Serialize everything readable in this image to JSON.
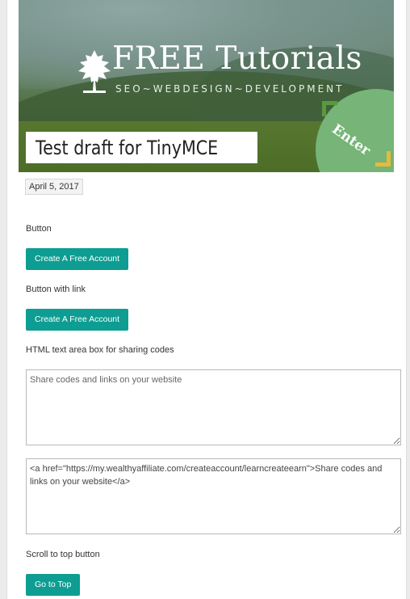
{
  "hero": {
    "brand": "FREE Tutorials",
    "tagline": "SEO~WEBDESIGN~DEVELOPMENT",
    "enter_label": "Enter"
  },
  "post": {
    "title": "Test draft for TinyMCE",
    "date": "April 5, 2017"
  },
  "sections": {
    "button_label": "Button",
    "button_text": "Create A Free Account",
    "button_link_label": "Button with link",
    "button_link_text": "Create A Free Account",
    "textarea_label": "HTML text area box for sharing codes",
    "textarea1_placeholder": "Share codes and links on your website",
    "textarea2_value": "<a href=\"https://my.wealthyaffiliate.com/createaccount/learncreateearn\">Share codes and links on your website</a>",
    "scroll_label": "Scroll to top button",
    "scroll_button": "Go to Top"
  },
  "colors": {
    "button": "#0e9d92",
    "enter_badge": "#76b577"
  }
}
